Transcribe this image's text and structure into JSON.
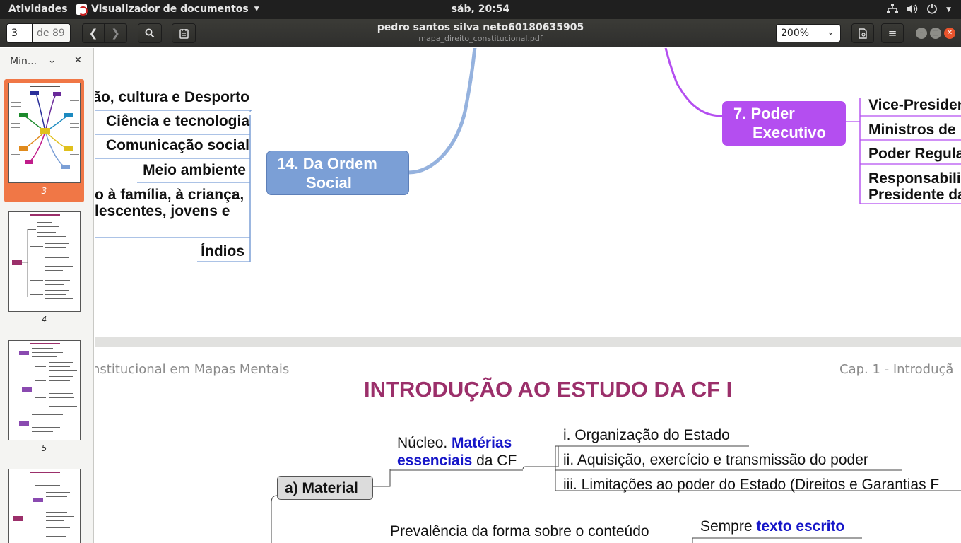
{
  "topbar": {
    "activities": "Atividades",
    "app_name": "Visualizador de documentos",
    "clock": "sáb, 20:54"
  },
  "header": {
    "page_current": "3",
    "page_total": "de 89",
    "doc_title": "pedro santos silva neto60180635905",
    "doc_file": "mapa_direito_constitucional.pdf",
    "zoom": "200%"
  },
  "sidebar": {
    "label": "Min...",
    "thumbnails": [
      {
        "num": "3",
        "selected": true
      },
      {
        "num": "4",
        "selected": false
      },
      {
        "num": "5",
        "selected": false
      },
      {
        "num": "",
        "selected": false
      }
    ]
  },
  "page3": {
    "left_leaves": [
      "ão, cultura e Desporto",
      "Ciência e tecnologia",
      "Comunicação social",
      "Meio ambiente",
      "o à família, à criança,",
      "lescentes, jovens e",
      "Índios"
    ],
    "center_node_line1": "14. Da Ordem",
    "center_node_line2": "Social",
    "right_node_line1": "7. Poder",
    "right_node_line2": "Executivo",
    "right_leaves": [
      "Vice-Presiden",
      "Ministros de",
      "Poder Regula",
      "Responsabili",
      "Presidente da"
    ],
    "colors": {
      "ordem_social": "#7b9fd6",
      "poder_executivo": "#b44ef0"
    }
  },
  "page4": {
    "header_left": "nstitucional em Mapas Mentais",
    "header_right": "Cap. 1 - Introduçã",
    "title": "INTRODUÇÃO AO ESTUDO DA CF I",
    "title_color": "#9b2f6a",
    "material_node": "a) Material",
    "nucleo_prefix": "Núcleo.",
    "nucleo_blue_1": "Matérias",
    "nucleo_blue_2": "essenciais",
    "nucleo_suffix": "da CF",
    "items": [
      "i. Organização do Estado",
      "ii. Aquisição, exercício e transmissão do poder",
      "iii. Limitações ao poder do Estado (Direitos e Garantias F"
    ],
    "prevalencia": "Prevalência da forma sobre o conteúdo",
    "sempre_prefix": "Sempre",
    "sempre_blue": "texto escrito"
  }
}
